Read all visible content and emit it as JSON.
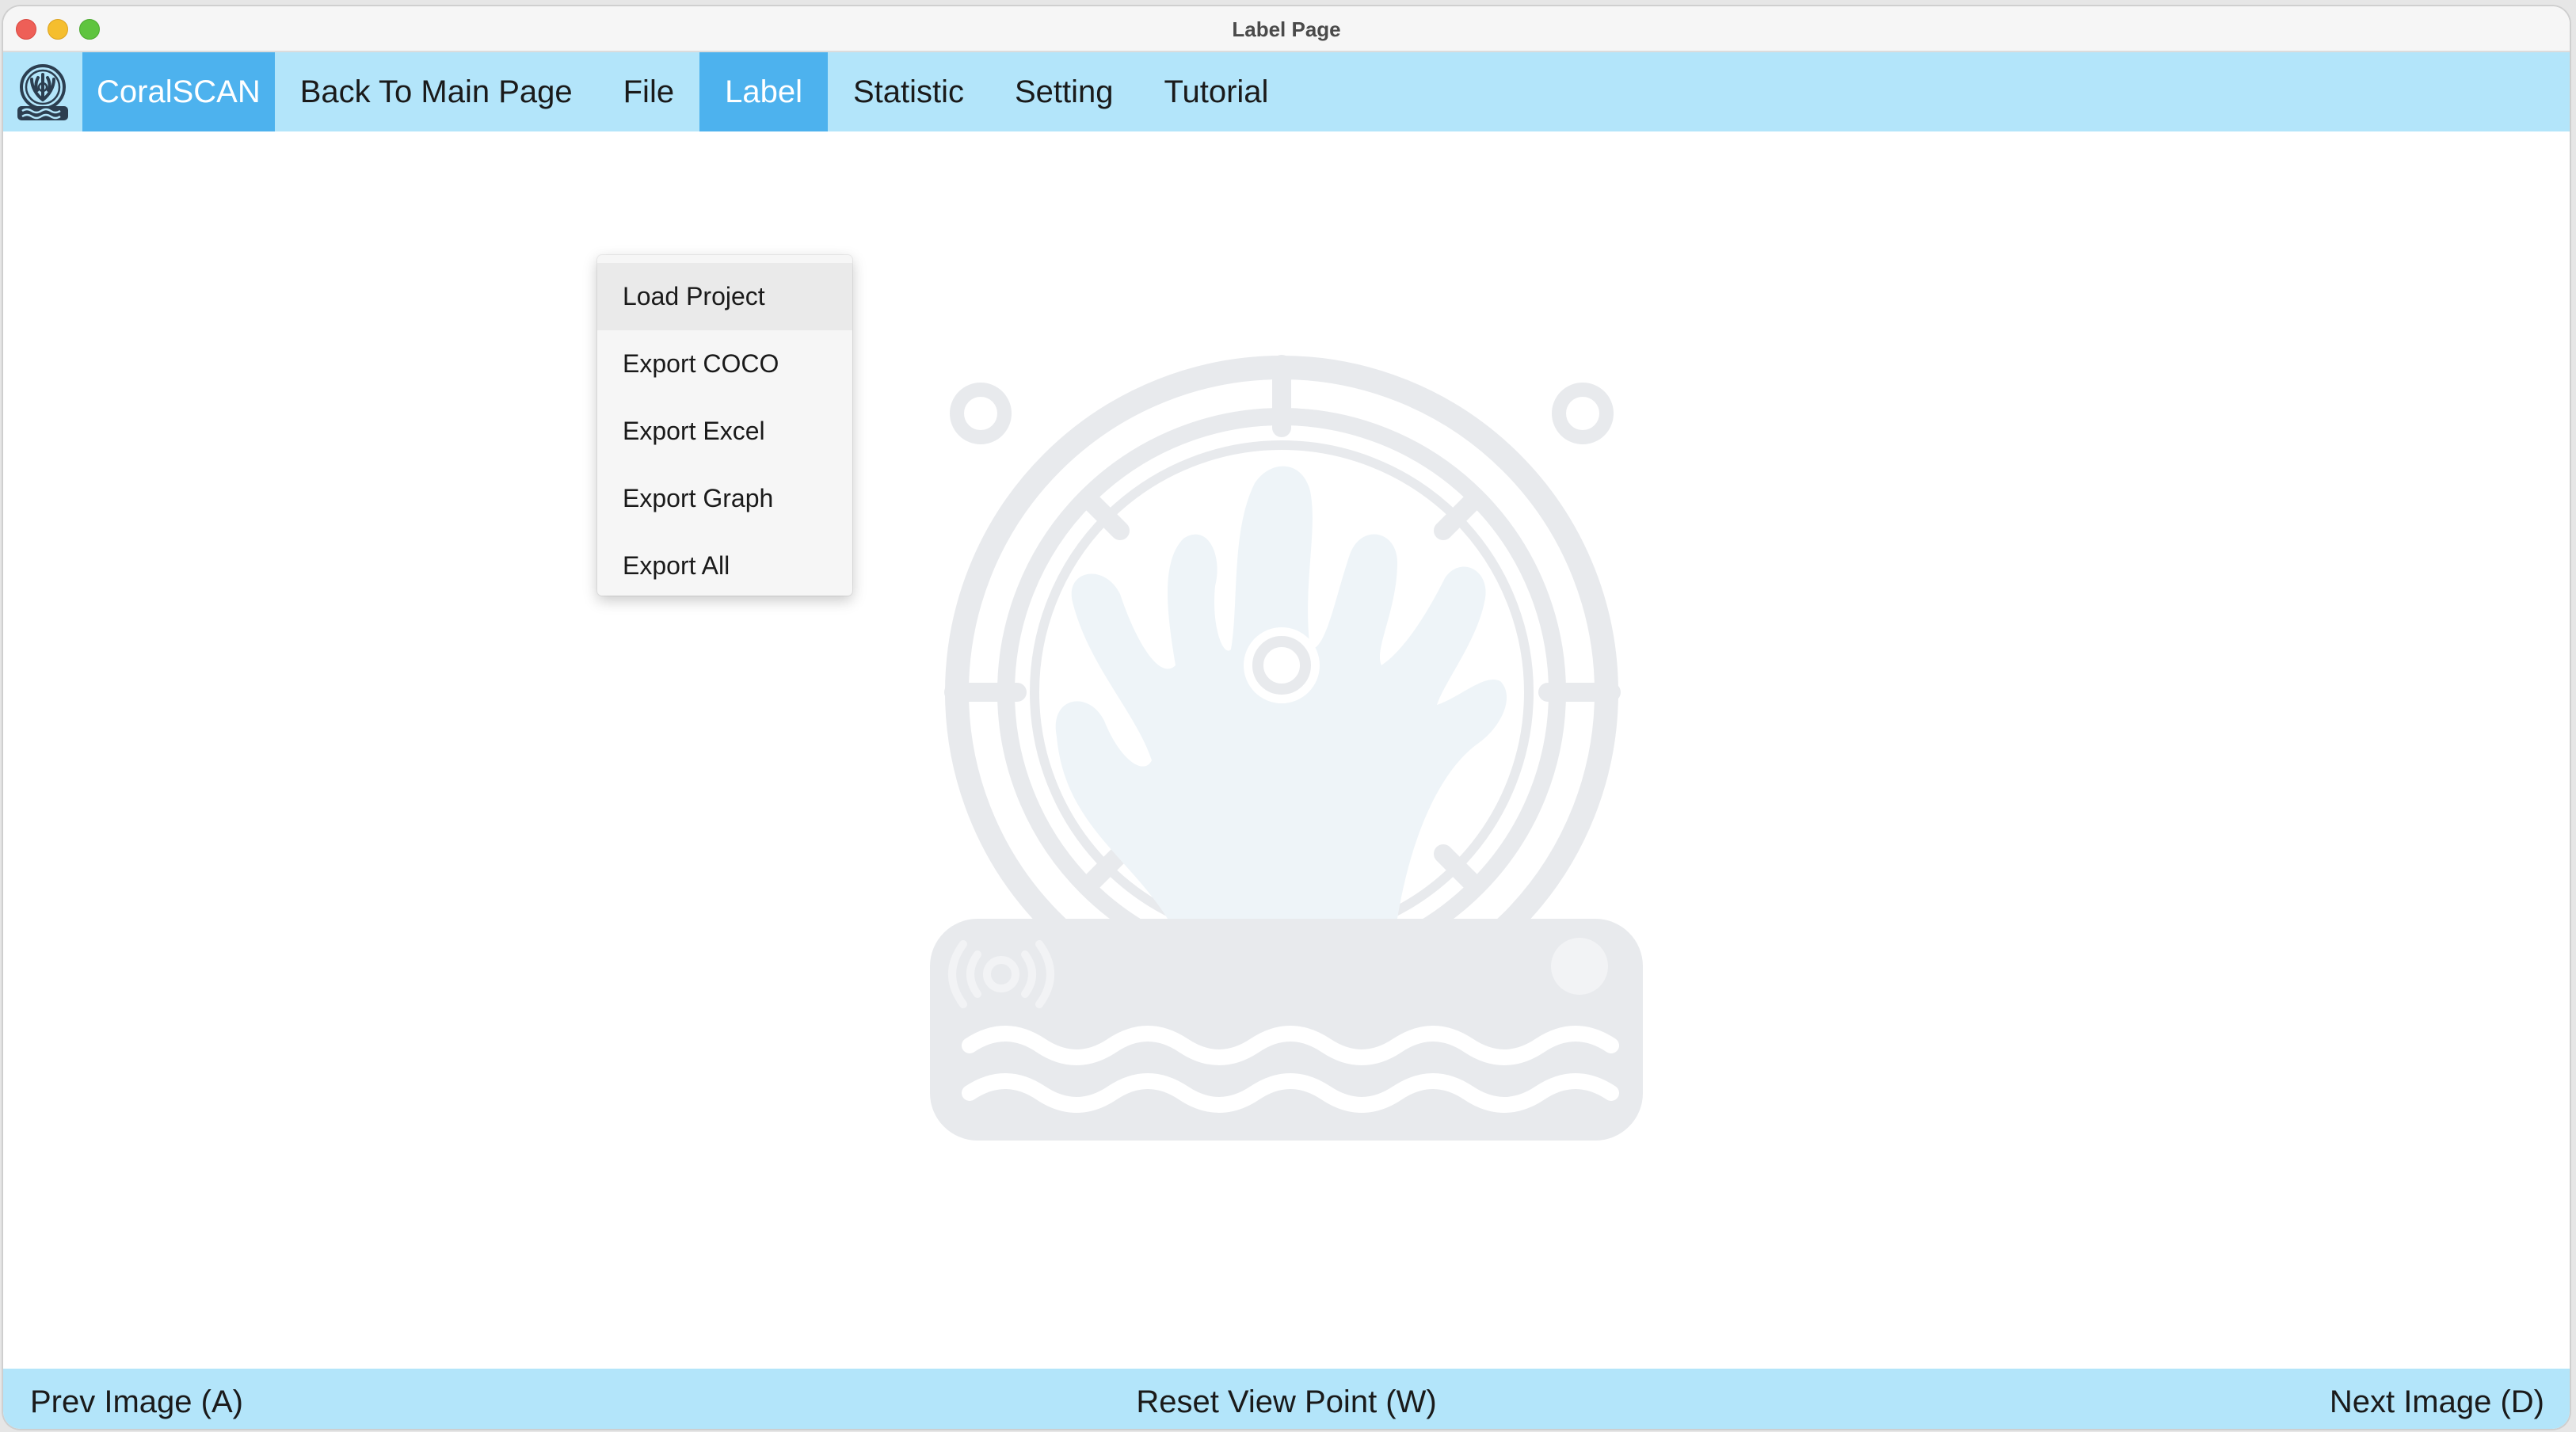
{
  "window": {
    "title": "Label Page"
  },
  "menubar": {
    "brand": "CoralSCAN",
    "items": [
      {
        "label": "Back To Main Page"
      },
      {
        "label": "File"
      },
      {
        "label": "Label"
      },
      {
        "label": "Statistic"
      },
      {
        "label": "Setting"
      },
      {
        "label": "Tutorial"
      }
    ],
    "active_item": "Label"
  },
  "dropdown": {
    "items": [
      {
        "label": "Load Project"
      },
      {
        "label": "Export COCO"
      },
      {
        "label": "Export Excel"
      },
      {
        "label": "Export Graph"
      },
      {
        "label": "Export All"
      }
    ]
  },
  "bottombar": {
    "prev_label": "Prev Image (A)",
    "reset_label": "Reset View Point (W)",
    "next_label": "Next Image (D)"
  },
  "colors": {
    "menubar_bg": "#b3e5fa",
    "active_bg": "#4db2ee",
    "watermark": "#e8eaed"
  },
  "icons": {
    "app_logo": "coral-logo-icon",
    "watermark": "coral-watermark-icon"
  }
}
